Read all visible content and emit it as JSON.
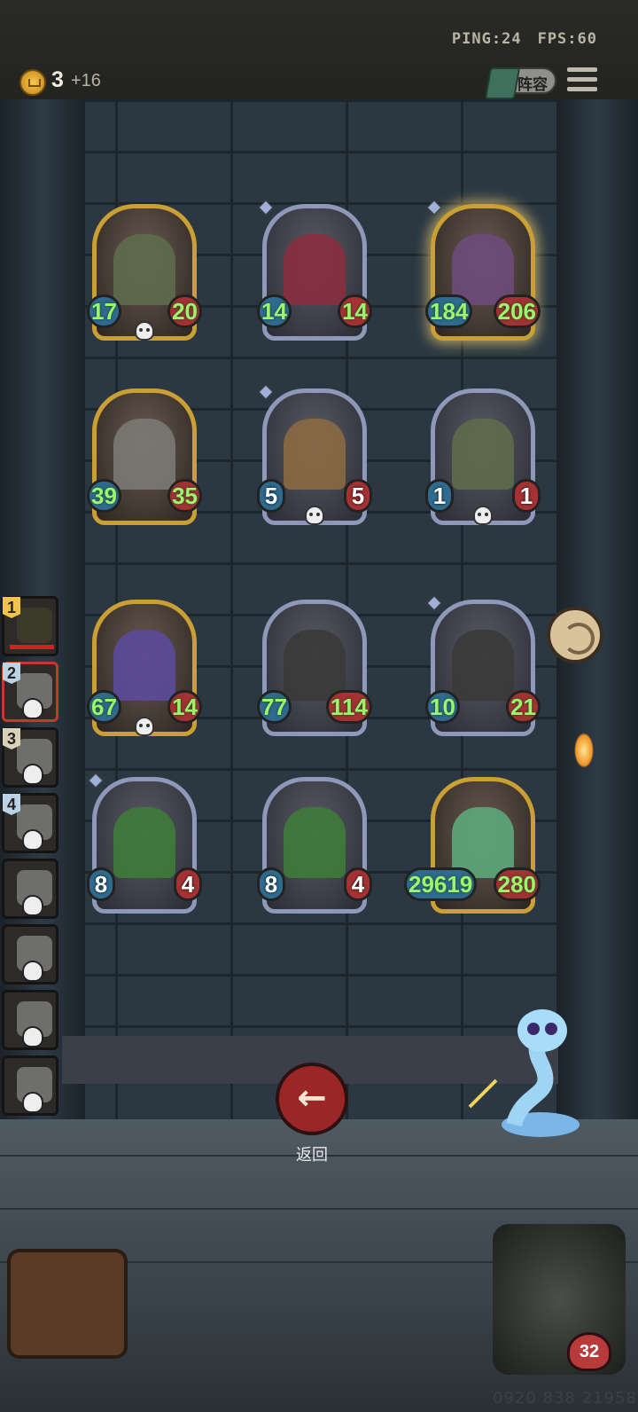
{
  "topbar": {
    "ping": "PING:24",
    "fps": "FPS:60",
    "gold": "3",
    "gold_plus": "+16",
    "lineup_label": "阵容"
  },
  "board": {
    "cards": [
      {
        "atk": "17",
        "hp": "20",
        "frame": "gold"
      },
      {
        "atk": "14",
        "hp": "14",
        "frame": "silver"
      },
      {
        "atk": "184",
        "hp": "206",
        "frame": "gold-glow"
      },
      {
        "atk": "39",
        "hp": "35",
        "frame": "gold"
      },
      {
        "atk": "5",
        "hp": "5",
        "frame": "silver"
      },
      {
        "atk": "1",
        "hp": "1",
        "frame": "silver"
      },
      {
        "atk": "67",
        "hp": "14",
        "frame": "gold"
      },
      {
        "atk": "77",
        "hp": "114",
        "frame": "silver"
      },
      {
        "atk": "10",
        "hp": "21",
        "frame": "silver"
      },
      {
        "atk": "8",
        "hp": "4",
        "frame": "silver"
      },
      {
        "atk": "8",
        "hp": "4",
        "frame": "silver"
      },
      {
        "atk": "29619",
        "hp": "280",
        "frame": "gold"
      }
    ]
  },
  "players": [
    {
      "rank": "1"
    },
    {
      "rank": "2"
    },
    {
      "rank": "3"
    },
    {
      "rank": "4"
    },
    {
      "rank": ""
    },
    {
      "rank": ""
    },
    {
      "rank": ""
    },
    {
      "rank": ""
    }
  ],
  "back_label": "返回",
  "hero_health": "32",
  "watermark_phone": "0920 838 21958",
  "colors": {
    "attack_bg": "#2f6b8f",
    "health_bg": "#a43233",
    "stat_text": "#9df56b",
    "back_button": "#9a2626"
  }
}
